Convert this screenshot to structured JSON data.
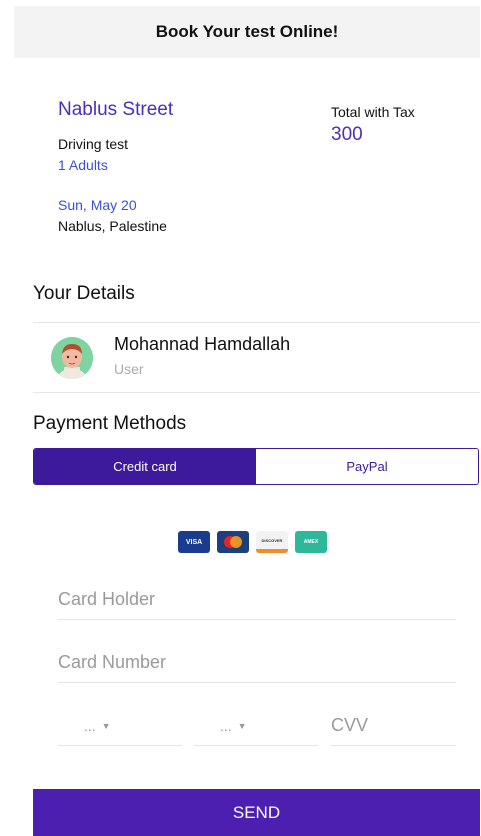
{
  "header": {
    "title": "Book Your test Online!"
  },
  "booking": {
    "street": "Nablus Street",
    "test_type": "Driving test",
    "adults": "1 Adults",
    "date": "Sun, May 20",
    "location": "Nablus, Palestine",
    "total_label": "Total with Tax",
    "total_value": "300"
  },
  "details": {
    "title": "Your Details",
    "user_name": "Mohannad Hamdallah",
    "user_role": "User"
  },
  "payment": {
    "title": "Payment Methods",
    "tabs": [
      "Credit card",
      "PayPal"
    ],
    "active_tab": "Credit card",
    "card_brands": [
      "VISA",
      "mastercard",
      "DISCOVER",
      "AMEX"
    ],
    "card_holder_placeholder": "Card Holder",
    "card_number_placeholder": "Card Number",
    "month_value": "...",
    "year_value": "...",
    "cvv_placeholder": "CVV"
  },
  "send_label": "SEND",
  "colors": {
    "accent": "#4d1fb0",
    "link": "#3b4fd8"
  }
}
